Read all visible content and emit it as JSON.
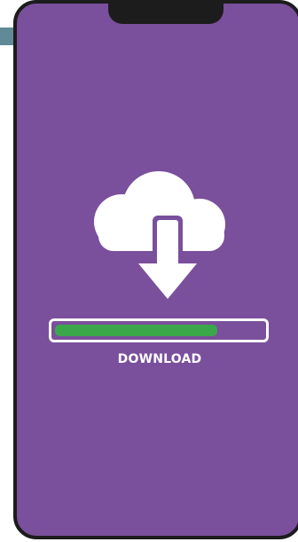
{
  "app": {
    "download_label": "DOWNLOAD",
    "progress": 0.78
  },
  "colors": {
    "screen_background": "#7a4f9c",
    "phone_frame": "#1c1c1c",
    "progress_fill": "#3aa84a",
    "icon": "#ffffff"
  },
  "icons": {
    "main": "cloud-download-icon"
  }
}
